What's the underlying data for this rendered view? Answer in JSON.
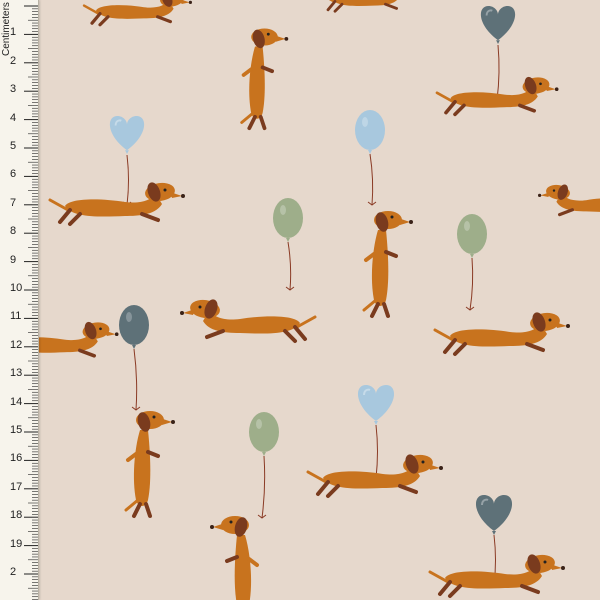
{
  "ruler": {
    "unit_label": "Centimeters",
    "numbers": [
      "1",
      "2",
      "3",
      "4",
      "5",
      "6",
      "7",
      "8",
      "9",
      "10",
      "11",
      "12",
      "13",
      "14",
      "15",
      "16",
      "17",
      "18",
      "19",
      "2"
    ]
  },
  "fabric": {
    "background": "#e6d8cc",
    "dog_color": "#c8731e",
    "ear_color": "#7a3b1e",
    "balloon_colors": {
      "light_blue": "#a8c8de",
      "sage_green": "#9eae8a",
      "slate_blue": "#5e7178"
    },
    "motifs": [
      "dachshund-with-heart-balloon",
      "dachshund-with-round-balloon"
    ]
  }
}
